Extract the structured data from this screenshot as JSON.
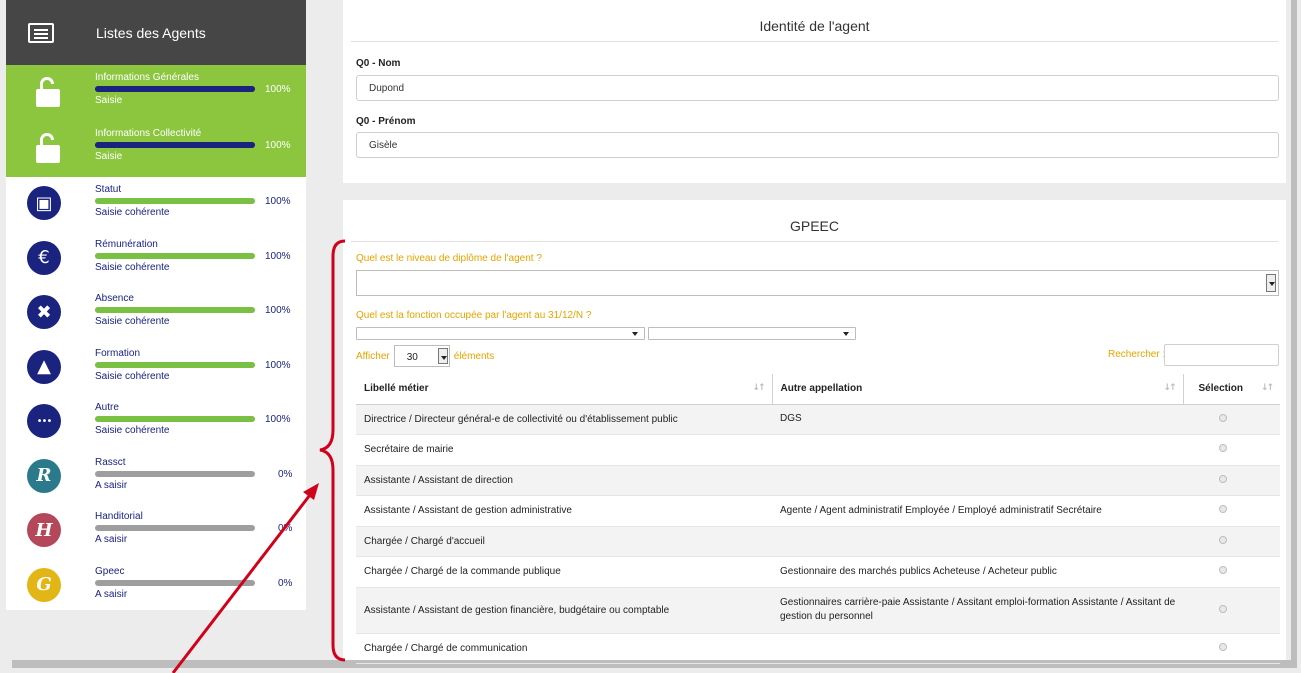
{
  "sidebar": {
    "header_title": "Listes des Agents",
    "items": [
      {
        "label": "Informations Générales",
        "status": "Saisie",
        "percent": "100%",
        "progress": 1.0,
        "icon": "unlock-icon"
      },
      {
        "label": "Informations Collectivité",
        "status": "Saisie",
        "percent": "100%",
        "progress": 1.0,
        "icon": "unlock-icon"
      },
      {
        "label": "Statut",
        "status": "Saisie cohérente",
        "percent": "100%",
        "progress": 1.0,
        "icon": "briefcase-icon"
      },
      {
        "label": "Rémunération",
        "status": "Saisie cohérente",
        "percent": "100%",
        "progress": 1.0,
        "icon": "euro-icon"
      },
      {
        "label": "Absence",
        "status": "Saisie cohérente",
        "percent": "100%",
        "progress": 1.0,
        "icon": "user-remove-icon"
      },
      {
        "label": "Formation",
        "status": "Saisie cohérente",
        "percent": "100%",
        "progress": 1.0,
        "icon": "graduation-cap-icon"
      },
      {
        "label": "Autre",
        "status": "Saisie cohérente",
        "percent": "100%",
        "progress": 1.0,
        "icon": "more-icon"
      },
      {
        "label": "Rassct",
        "status": "A saisir",
        "percent": "0%",
        "progress": 0,
        "icon": "letter-r-icon",
        "color": "#2a7a8c",
        "glyph": "R"
      },
      {
        "label": "Handitorial",
        "status": "A saisir",
        "percent": "0%",
        "progress": 0,
        "icon": "letter-h-icon",
        "color": "#b5475a",
        "glyph": "H"
      },
      {
        "label": "Gpeec",
        "status": "A saisir",
        "percent": "0%",
        "progress": 0,
        "icon": "letter-g-icon",
        "color": "#e2b616",
        "glyph": "G"
      }
    ]
  },
  "identity": {
    "title": "Identité de l'agent",
    "nom_label": "Q0 - Nom",
    "nom_value": "Dupond",
    "prenom_label": "Q0 - Prénom",
    "prenom_value": "Gisèle"
  },
  "gpeec": {
    "title": "GPEEC",
    "q_diploma": "Quel est le niveau de diplôme de l'agent ?",
    "q_function": "Quel est la fonction occupée par l'agent au 31/12/N ?",
    "show_prefix": "Afficher",
    "show_value": "30",
    "show_suffix": "éléments",
    "search_label": "Rechercher :",
    "columns": [
      "Libellé métier",
      "Autre appellation",
      "Sélection"
    ],
    "rows": [
      {
        "metier": "Directrice / Directeur général-e de collectivité ou d'établissement public",
        "autre": "DGS"
      },
      {
        "metier": "Secrétaire de mairie",
        "autre": ""
      },
      {
        "metier": "Assistante / Assistant de direction",
        "autre": ""
      },
      {
        "metier": "Assistante / Assistant de gestion administrative",
        "autre": "Agente / Agent administratif Employée / Employé administratif Secrétaire"
      },
      {
        "metier": "Chargée / Chargé d'accueil",
        "autre": ""
      },
      {
        "metier": "Chargée / Chargé de la commande publique",
        "autre": "Gestionnaire des marchés publics Acheteuse / Acheteur public"
      },
      {
        "metier": "Assistante / Assistant de gestion financière, budgétaire ou comptable",
        "autre": "Gestionnaires carrière-paie Assistante / Assitant emploi-formation Assistante / Assitant de gestion du personnel"
      },
      {
        "metier": "Chargée / Chargé de communication",
        "autre": ""
      }
    ]
  },
  "colors": {
    "sidebar_header": "#464646",
    "sidebar_active": "#8cc63f",
    "navy": "#1a237e",
    "question": "#e5a300",
    "annotation": "#d0021b"
  }
}
